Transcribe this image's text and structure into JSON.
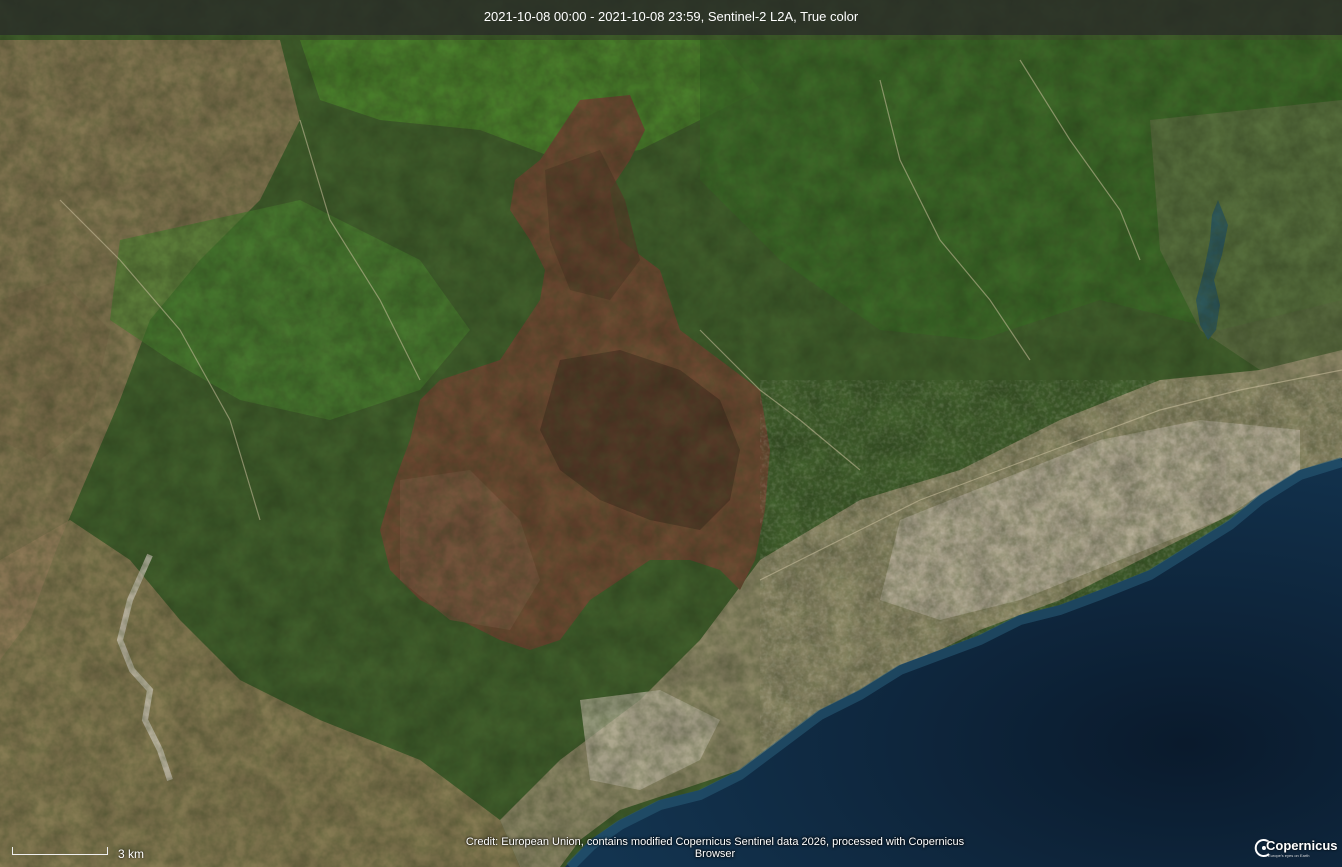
{
  "header": {
    "title": "2021-10-08 00:00 - 2021-10-08 23:59, Sentinel-2 L2A, True color"
  },
  "map": {
    "imagery": "Sentinel-2 L2A true color satellite image",
    "colors": {
      "forest": "#3f6a2a",
      "forest_dark": "#2d4f1f",
      "bright_green": "#4f8f2e",
      "farmland": "#8f7d5a",
      "dry_land": "#a08a66",
      "burn_scar": "#6e4a32",
      "burn_scar_dark": "#4e3424",
      "urban": "#b8b19e",
      "sea": "#0d1f33",
      "sea_shallow": "#1d4660",
      "reservoir": "#2f5a5c",
      "riverbed": "#c9c4b4"
    }
  },
  "scale": {
    "label": "3 km"
  },
  "credit": {
    "text": "Credit: European Union, contains modified Copernicus Sentinel data 2026, processed with Copernicus Browser"
  },
  "logo": {
    "text": "Copernicus",
    "subtext": "Europe's eyes on Earth"
  }
}
